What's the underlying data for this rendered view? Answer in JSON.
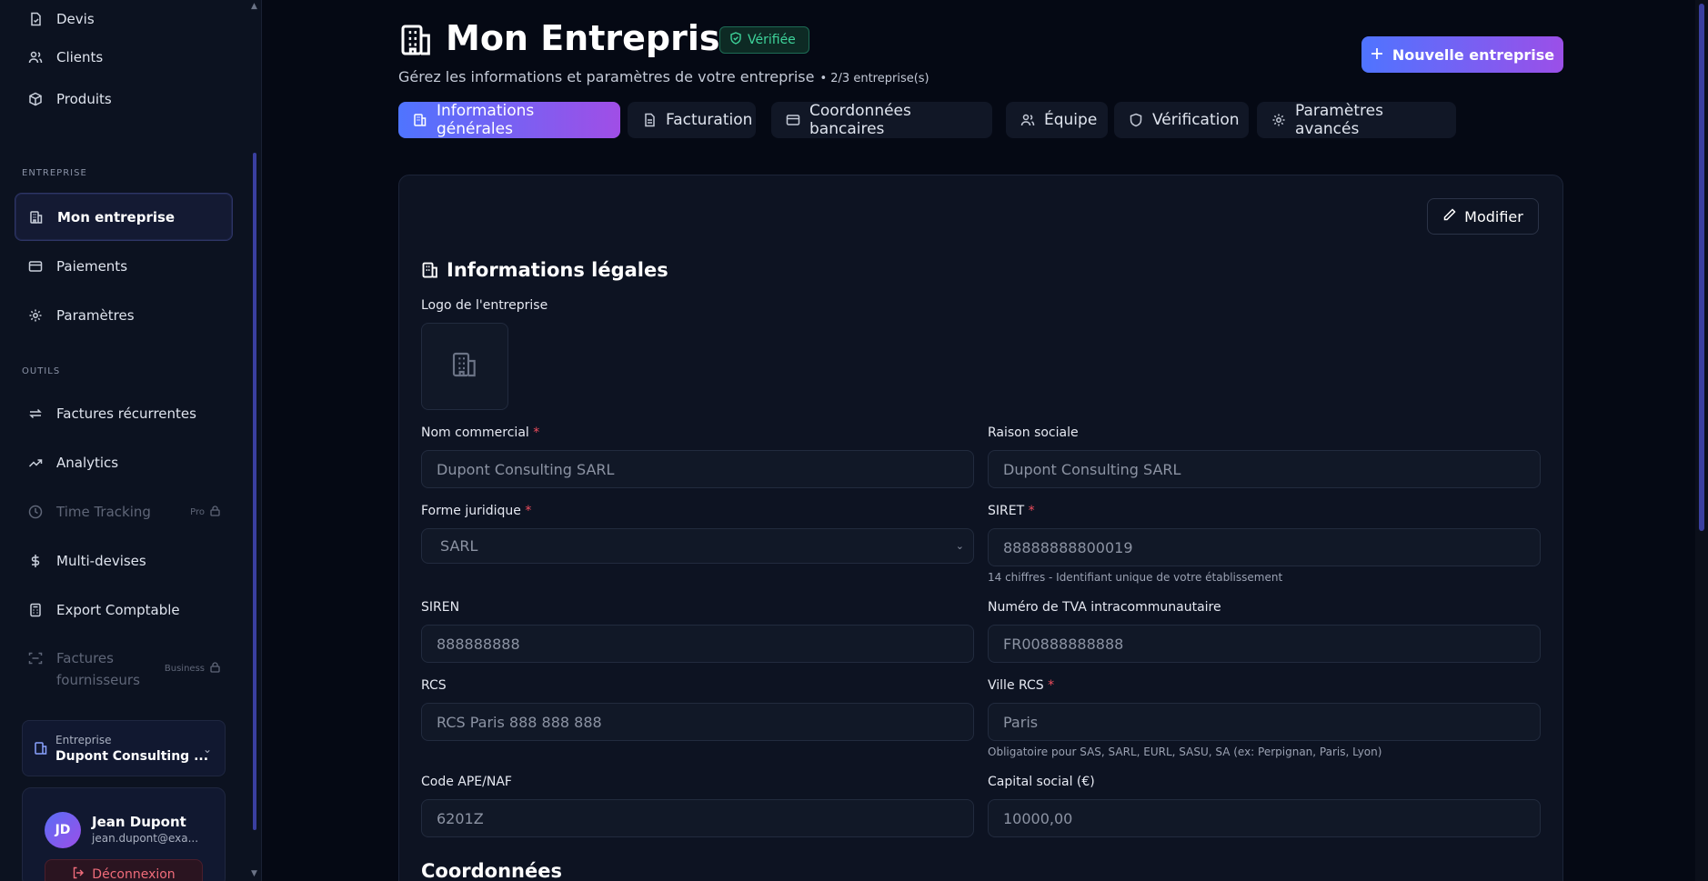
{
  "sidebar": {
    "items_top": [
      {
        "label": "Devis",
        "icon": "file-check-icon"
      },
      {
        "label": "Clients",
        "icon": "users-icon"
      },
      {
        "label": "Produits",
        "icon": "box-icon"
      }
    ],
    "section_entreprise": "ENTREPRISE",
    "items_entreprise": [
      {
        "label": "Mon entreprise",
        "icon": "building-icon"
      },
      {
        "label": "Paiements",
        "icon": "credit-card-icon"
      },
      {
        "label": "Paramètres",
        "icon": "gear-icon"
      }
    ],
    "section_outils": "OUTILS",
    "items_outils": [
      {
        "label": "Factures récurrentes",
        "icon": "repeat-icon"
      },
      {
        "label": "Analytics",
        "icon": "trend-icon"
      },
      {
        "label": "Time Tracking",
        "icon": "clock-icon",
        "tag": "Pro"
      },
      {
        "label": "Multi-devises",
        "icon": "dollar-icon"
      },
      {
        "label": "Export Comptable",
        "icon": "calculator-icon"
      },
      {
        "label_line1": "Factures",
        "label_line2": "fournisseurs",
        "icon": "scan-icon",
        "tag": "Business"
      }
    ],
    "org_switcher": {
      "small": "Entreprise",
      "name": "Dupont Consulting ..."
    },
    "user": {
      "initials": "JD",
      "name": "Jean Dupont",
      "email": "jean.dupont@exa...",
      "logout": "Déconnexion"
    }
  },
  "header": {
    "title": "Mon Entreprise",
    "badge": "Vérifiée",
    "subtitle": "Gérez les informations et paramètres de votre entreprise",
    "count": "• 2/3 entreprise(s)",
    "new_button": "Nouvelle entreprise"
  },
  "tabs": [
    {
      "label": "Informations générales",
      "icon": "building-icon"
    },
    {
      "label": "Facturation",
      "icon": "file-icon"
    },
    {
      "label": "Coordonnées bancaires",
      "icon": "credit-card-icon"
    },
    {
      "label": "Équipe",
      "icon": "users-icon"
    },
    {
      "label": "Vérification",
      "icon": "shield-icon"
    },
    {
      "label": "Paramètres avancés",
      "icon": "gear-icon"
    }
  ],
  "card": {
    "edit_button": "Modifier",
    "section_title": "Informations légales",
    "logo_label": "Logo de l'entreprise",
    "fields": {
      "nom_commercial": {
        "label": "Nom commercial",
        "value": "Dupont Consulting SARL"
      },
      "raison_sociale": {
        "label": "Raison sociale",
        "value": "Dupont Consulting SARL"
      },
      "forme_juridique": {
        "label": "Forme juridique",
        "value": "SARL"
      },
      "siret": {
        "label": "SIRET",
        "value": "88888888800019",
        "helper": "14 chiffres - Identifiant unique de votre établissement"
      },
      "siren": {
        "label": "SIREN",
        "value": "888888888"
      },
      "tva": {
        "label": "Numéro de TVA intracommunautaire",
        "value": "FR00888888888"
      },
      "rcs": {
        "label": "RCS",
        "value": "RCS Paris 888 888 888"
      },
      "ville_rcs": {
        "label": "Ville RCS",
        "value": "Paris",
        "helper": "Obligatoire pour SAS, SARL, EURL, SASU, SA (ex: Perpignan, Paris, Lyon)"
      },
      "ape": {
        "label": "Code APE/NAF",
        "value": "6201Z"
      },
      "capital": {
        "label": "Capital social (€)",
        "value": "10000,00"
      }
    },
    "next_section": "Coordonnées",
    "required_mark": "*"
  }
}
